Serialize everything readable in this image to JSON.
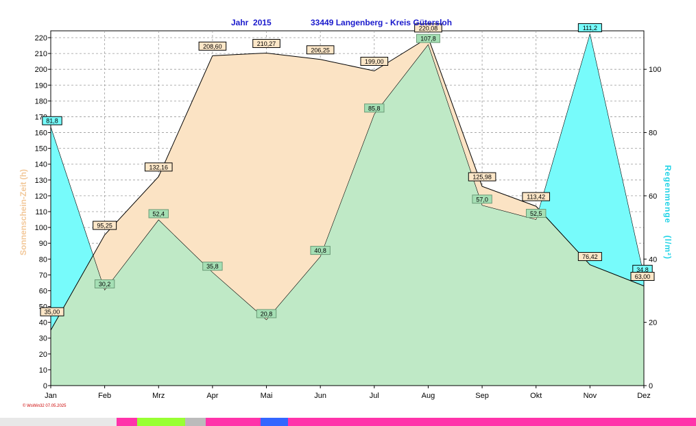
{
  "header": {
    "year_label": "Jahr  2015",
    "location_label": "33449 Langenberg - Kreis Gütersloh"
  },
  "axes": {
    "left_label": "Sonnenschein-Zeit   (h)",
    "right_label": "Regenmenge    (l/m²)"
  },
  "footer": {
    "credit": "© WsWin32  07.05.2025"
  },
  "colors": {
    "sunshine_fill": "#fbe3c4",
    "rain_fill": "#77fbfb",
    "overlap_fill": "#bfe9c6",
    "sun_label_bg": "#fde7c8",
    "rain_label_bg": "#77fbfb",
    "title": "#1a1acc"
  },
  "chart_data": {
    "type": "area",
    "categories": [
      "Jan",
      "Feb",
      "Mrz",
      "Apr",
      "Mai",
      "Jun",
      "Jul",
      "Aug",
      "Sep",
      "Okt",
      "Nov",
      "Dez"
    ],
    "series": [
      {
        "axis": "left",
        "values": [
          35.0,
          95.25,
          132.16,
          208.6,
          210.27,
          206.25,
          199.0,
          220.08,
          125.98,
          113.42,
          76.42,
          63.0
        ],
        "labels": [
          "35,00",
          "95,25",
          "132,16",
          "208,60",
          "210,27",
          "206,25",
          "199,00",
          "220,08",
          "125,98",
          "113,42",
          "76,42",
          "63,00"
        ]
      },
      {
        "axis": "right",
        "values": [
          81.8,
          30.2,
          52.4,
          35.8,
          20.8,
          40.8,
          85.8,
          107.8,
          57.0,
          52.5,
          111.2,
          34.8
        ],
        "labels": [
          "81,8",
          "30,2",
          "52,4",
          "35,8",
          "20,8",
          "40,8",
          "85,8",
          "107,8",
          "57,0",
          "52,5",
          "111,2",
          "34,8"
        ]
      }
    ],
    "left_axis": {
      "min": 0,
      "max": 220,
      "step": 10,
      "ticks": [
        "0",
        "10",
        "20",
        "30",
        "40",
        "50",
        "60",
        "70",
        "80",
        "90",
        "100",
        "110",
        "120",
        "130",
        "140",
        "150",
        "160",
        "170",
        "180",
        "190",
        "200",
        "210",
        "220"
      ]
    },
    "right_axis": {
      "min": 0,
      "max": 110,
      "ticks": [
        "0",
        "20",
        "40",
        "60",
        "80",
        "100"
      ]
    },
    "grid": true
  }
}
